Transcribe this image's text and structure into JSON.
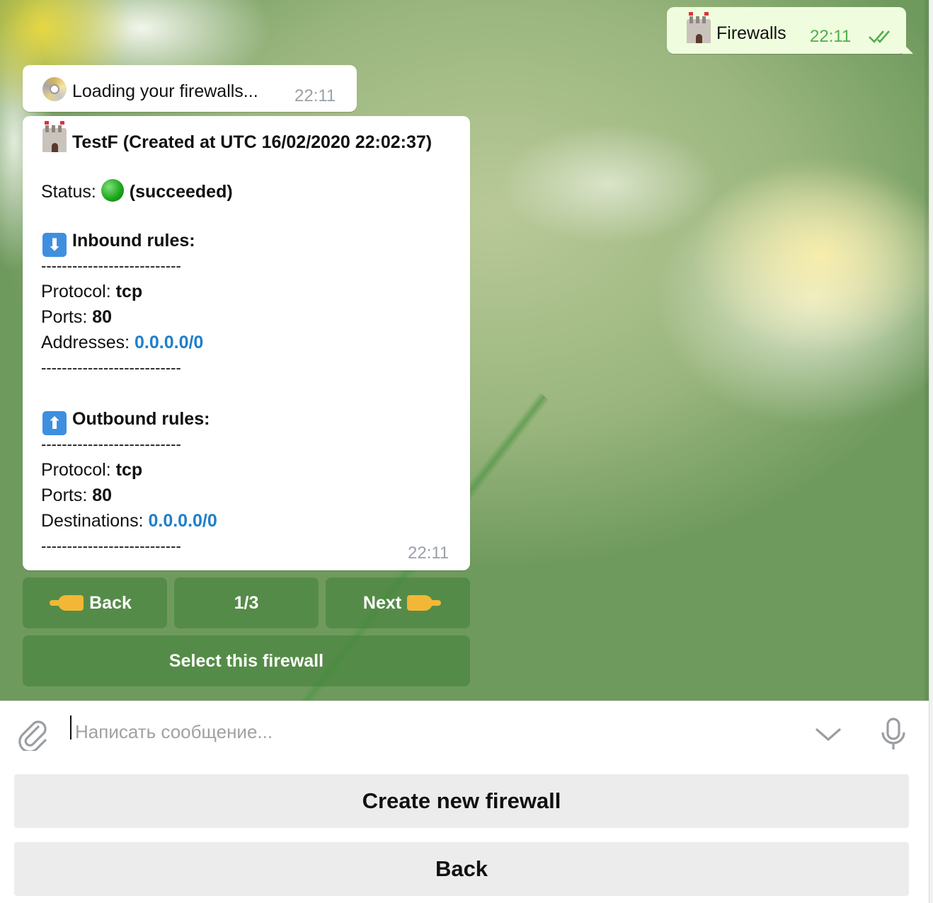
{
  "chat": {
    "outgoing": {
      "text": "Firewalls",
      "time": "22:11",
      "icon": "castle-icon",
      "status_icon": "double-check-icon"
    },
    "loading_message": {
      "text": "Loading your firewalls...",
      "time": "22:11",
      "icon": "disc-icon"
    },
    "firewall_card": {
      "title": "TestF (Created at UTC 16/02/2020 22:02:37)",
      "status_label": "Status:",
      "status_value": "(succeeded)",
      "status_icon": "green-circle-icon",
      "inbound_heading": "Inbound rules:",
      "inbound": {
        "separator": "---------------------------",
        "protocol_label": "Protocol:",
        "protocol": "tcp",
        "ports_label": "Ports:",
        "ports": "80",
        "addresses_label": "Addresses:",
        "addresses": "0.0.0.0/0"
      },
      "outbound_heading": "Outbound rules:",
      "outbound": {
        "separator": "---------------------------",
        "protocol_label": "Protocol:",
        "protocol": "tcp",
        "ports_label": "Ports:",
        "ports": "80",
        "destinations_label": "Destinations:",
        "destinations": "0.0.0.0/0"
      },
      "time": "22:11"
    },
    "inline_keyboard": {
      "back": "Back",
      "page": "1/3",
      "next": "Next",
      "select": "Select this firewall"
    }
  },
  "composer": {
    "placeholder": "Написать сообщение..."
  },
  "reply_keyboard": {
    "create": "Create new firewall",
    "back": "Back"
  },
  "colors": {
    "outgoing_bubble": "#effdde",
    "link": "#1f7fca",
    "outgoing_time": "#4fae4e"
  }
}
